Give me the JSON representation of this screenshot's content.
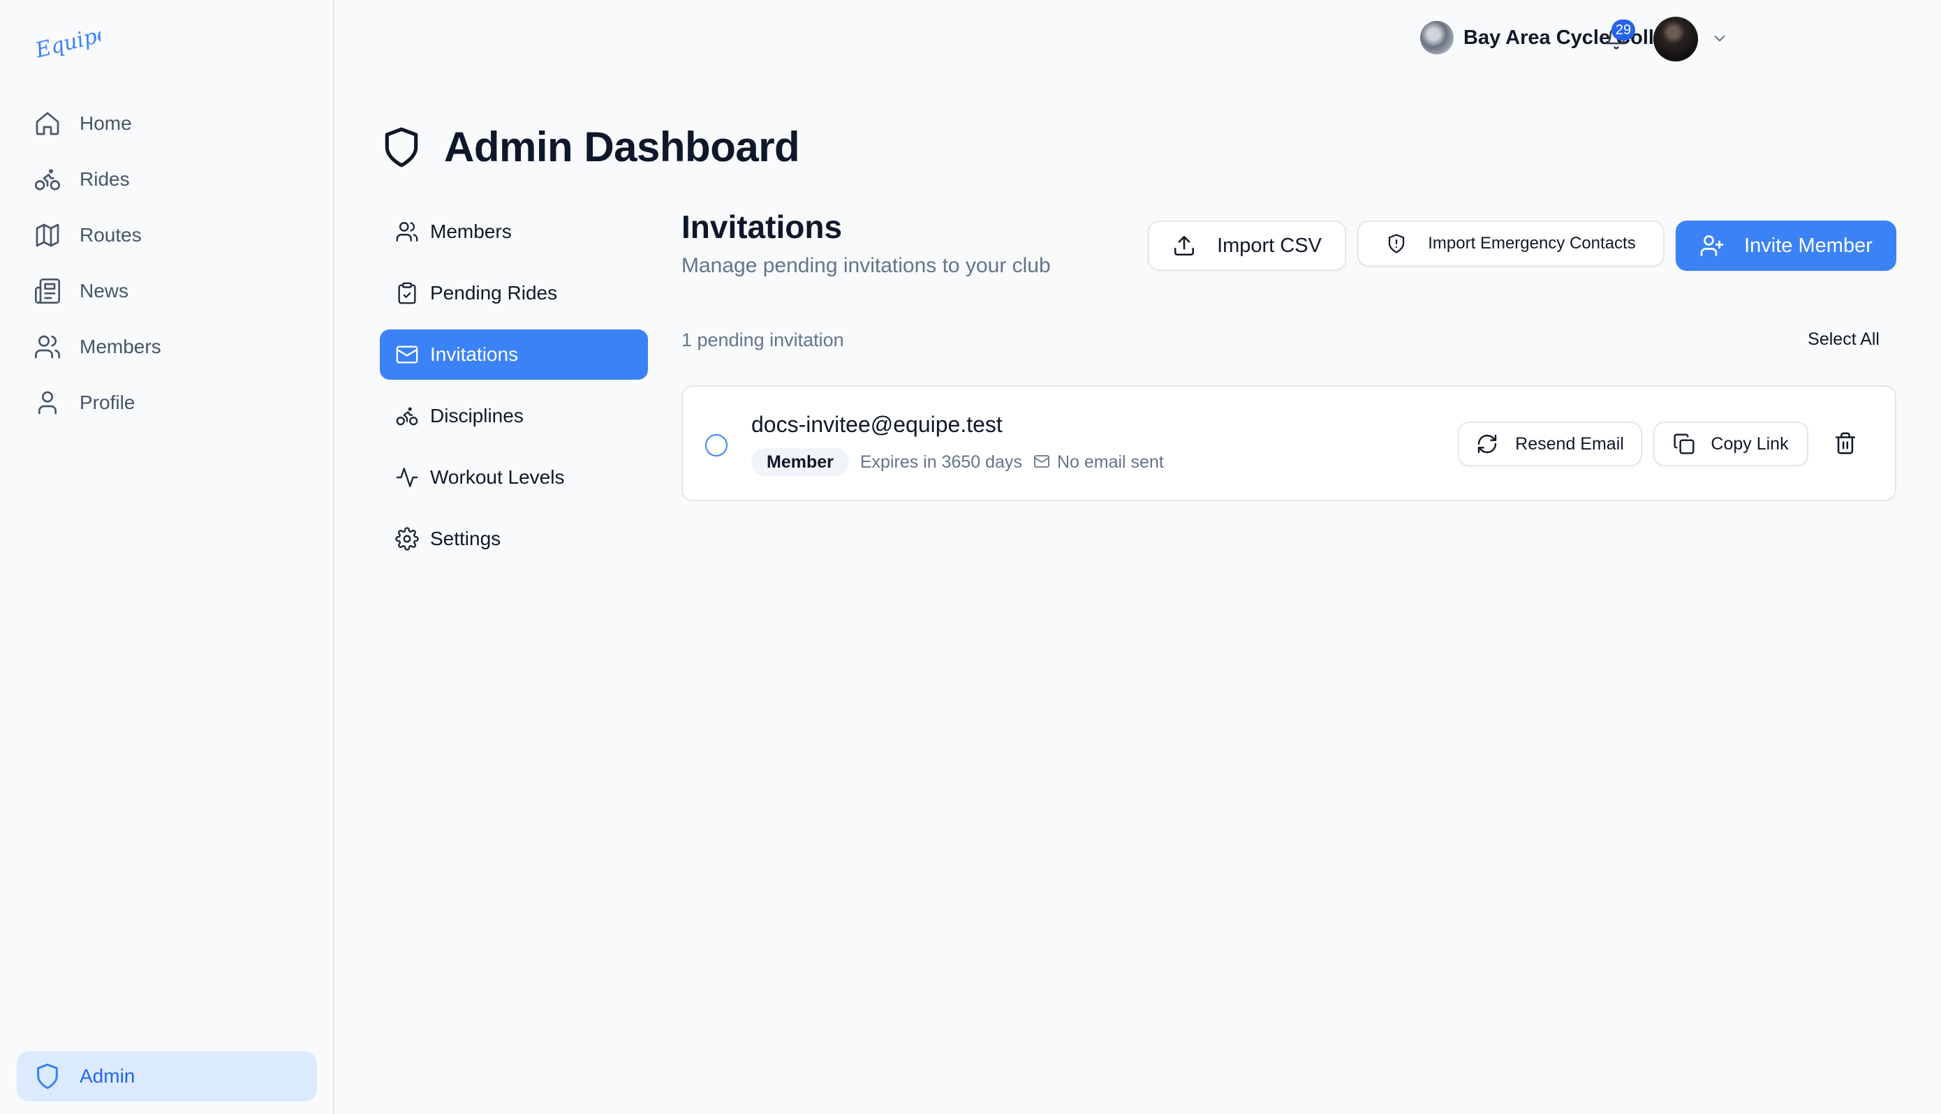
{
  "brand": {
    "logo_text": "Equipe",
    "accent": "#3b82f6"
  },
  "sidebar": {
    "items": [
      {
        "label": "Home",
        "icon": "home-icon"
      },
      {
        "label": "Rides",
        "icon": "bike-icon"
      },
      {
        "label": "Routes",
        "icon": "map-icon"
      },
      {
        "label": "News",
        "icon": "newspaper-icon"
      },
      {
        "label": "Members",
        "icon": "users-icon"
      },
      {
        "label": "Profile",
        "icon": "user-icon"
      }
    ],
    "admin_label": "Admin"
  },
  "topbar": {
    "club_name": "Bay Area Cycle Coll...",
    "notification_count": "29"
  },
  "page": {
    "title": "Admin Dashboard"
  },
  "subnav": {
    "items": [
      {
        "label": "Members",
        "icon": "users-icon"
      },
      {
        "label": "Pending Rides",
        "icon": "clipboard-check-icon"
      },
      {
        "label": "Invitations",
        "icon": "mail-icon",
        "active": true
      },
      {
        "label": "Disciplines",
        "icon": "bike-icon"
      },
      {
        "label": "Workout Levels",
        "icon": "activity-icon"
      },
      {
        "label": "Settings",
        "icon": "gear-icon"
      }
    ]
  },
  "invitations": {
    "title": "Invitations",
    "subtitle": "Manage pending invitations to your club",
    "import_csv_label": "Import CSV",
    "import_emergency_label": "Import Emergency Contacts",
    "invite_member_label": "Invite Member",
    "pending_count_text": "1 pending invitation",
    "select_all_label": "Select All",
    "items": [
      {
        "email": "docs-invitee@equipe.test",
        "role": "Member",
        "expires": "Expires in 3650 days",
        "email_status": "No email sent",
        "resend_label": "Resend Email",
        "copy_label": "Copy Link"
      }
    ]
  }
}
